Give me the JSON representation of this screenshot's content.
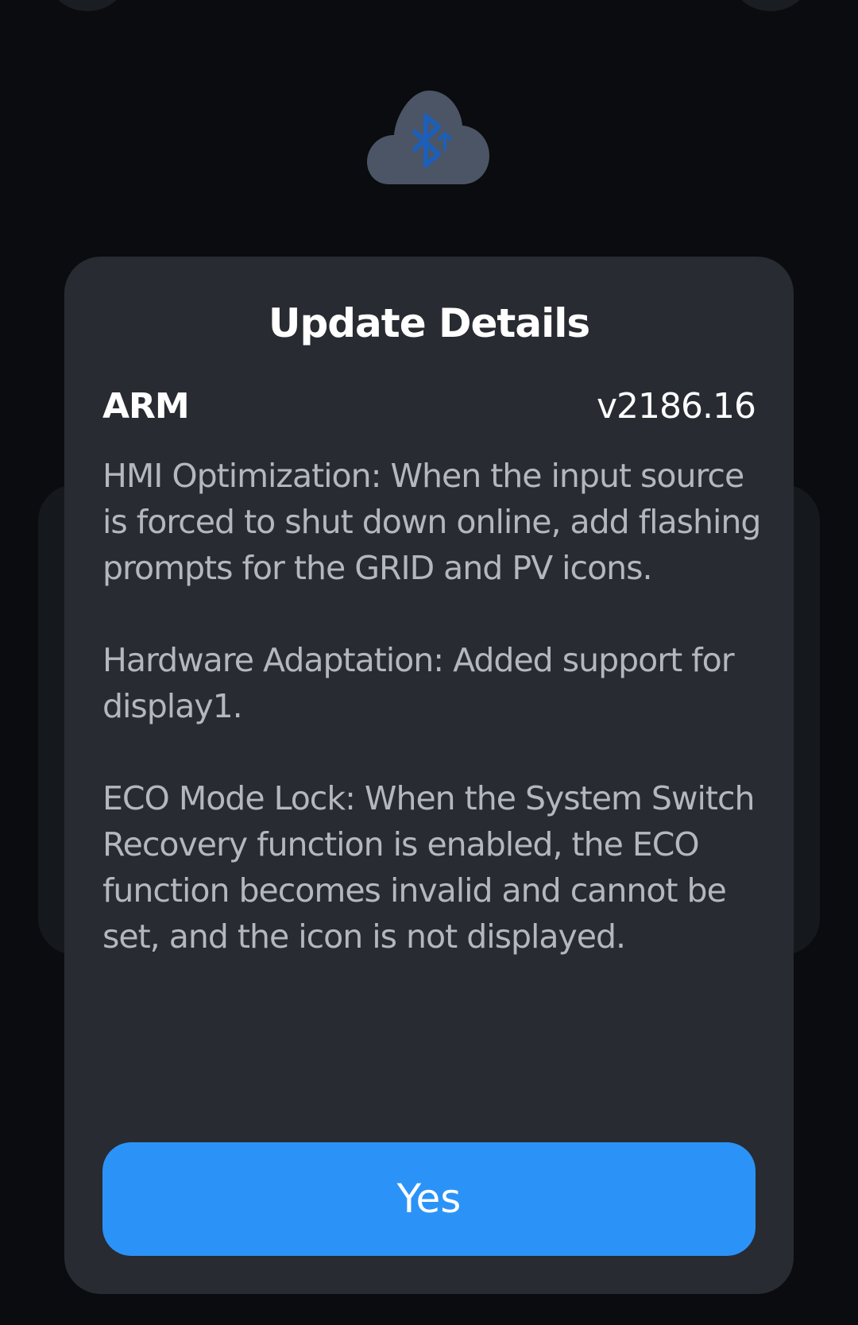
{
  "dialog": {
    "title": "Update Details",
    "module": {
      "name": "ARM",
      "version": "v2186.16"
    },
    "notes": [
      "HMI Optimization: When the input source is forced to shut down online, add flashing prompts for the GRID and PV icons.",
      "Hardware Adaptation: Added support for display1.",
      "ECO Mode Lock: When the System Switch Recovery function is enabled, the ECO function becomes invalid and cannot be set, and the icon is not displayed."
    ],
    "confirm_label": "Yes"
  },
  "icons": {
    "hero": "bluetooth-cloud-upload-icon"
  },
  "colors": {
    "background": "#0a0c0f",
    "dialog": "#282b31",
    "accent": "#2b93f7",
    "body_text": "#b4b7bd",
    "icon_cloud": "#4b5565",
    "icon_glyph": "#1d5fb8"
  }
}
